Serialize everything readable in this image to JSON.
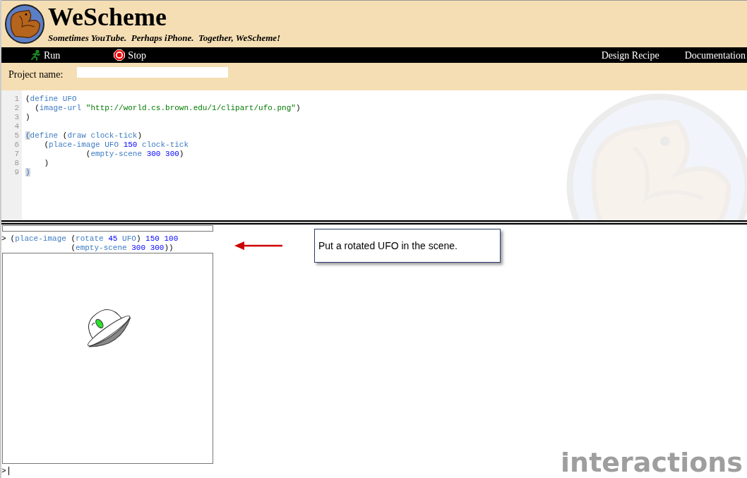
{
  "header": {
    "title": "WeScheme",
    "tagline": "Sometimes YouTube.  Perhaps iPhone.  Together, WeScheme!"
  },
  "toolbar": {
    "left": [
      {
        "kind": "run",
        "label": "Run"
      },
      {
        "kind": "stop",
        "label": "Stop"
      }
    ],
    "right": [
      "Design Recipe",
      "Documentation"
    ]
  },
  "project": {
    "label": "Project name:"
  },
  "editor": {
    "lines": [
      {
        "number": "1",
        "tokens": [
          {
            "kind": "plain",
            "text": "("
          },
          {
            "kind": "id",
            "text": "define UFO"
          }
        ]
      },
      {
        "number": "2",
        "tokens": [
          {
            "kind": "plain",
            "text": "  ("
          },
          {
            "kind": "id",
            "text": "image-url "
          },
          {
            "kind": "str",
            "text": "\"http://world.cs.brown.edu/1/clipart/ufo.png\""
          },
          {
            "kind": "plain",
            "text": ")"
          }
        ]
      },
      {
        "number": "3",
        "tokens": [
          {
            "kind": "plain",
            "text": ")"
          }
        ]
      },
      {
        "number": "4"
      },
      {
        "number": "5",
        "tokens": [
          {
            "kind": "match",
            "text": "("
          },
          {
            "kind": "id",
            "text": "define "
          },
          {
            "kind": "plain",
            "text": "("
          },
          {
            "kind": "id",
            "text": "draw clock-tick"
          },
          {
            "kind": "plain",
            "text": ")"
          }
        ]
      },
      {
        "number": "6",
        "tokens": [
          {
            "kind": "plain",
            "text": "    ("
          },
          {
            "kind": "id",
            "text": "place-image UFO "
          },
          {
            "kind": "num",
            "text": "150"
          },
          {
            "kind": "id",
            "text": " clock-tick"
          }
        ]
      },
      {
        "number": "7",
        "tokens": [
          {
            "kind": "plain",
            "text": "             ("
          },
          {
            "kind": "id",
            "text": "empty-scene "
          },
          {
            "kind": "num",
            "text": "300 300"
          },
          {
            "kind": "plain",
            "text": ")"
          }
        ]
      },
      {
        "number": "8",
        "tokens": [
          {
            "kind": "plain",
            "text": "    )"
          }
        ]
      },
      {
        "number": "9",
        "tokens": [
          {
            "kind": "match",
            "text": ")"
          }
        ]
      }
    ]
  },
  "interactions": {
    "prompt": ">",
    "lines": [
      [
        {
          "kind": "plain",
          "text": "("
        },
        {
          "kind": "id",
          "text": "place-image "
        },
        {
          "kind": "plain",
          "text": "("
        },
        {
          "kind": "id",
          "text": "rotate "
        },
        {
          "kind": "num",
          "text": "45"
        },
        {
          "kind": "id",
          "text": " UFO"
        },
        {
          "kind": "plain",
          "text": ") "
        },
        {
          "kind": "num",
          "text": "150 100"
        }
      ],
      [
        {
          "kind": "plain",
          "text": "             ("
        },
        {
          "kind": "id",
          "text": "empty-scene "
        },
        {
          "kind": "num",
          "text": "300 300"
        },
        {
          "kind": "plain",
          "text": "))"
        }
      ]
    ],
    "input_prompt": ">",
    "label": "interactions"
  },
  "callout": {
    "text": "Put a rotated UFO in the scene."
  }
}
